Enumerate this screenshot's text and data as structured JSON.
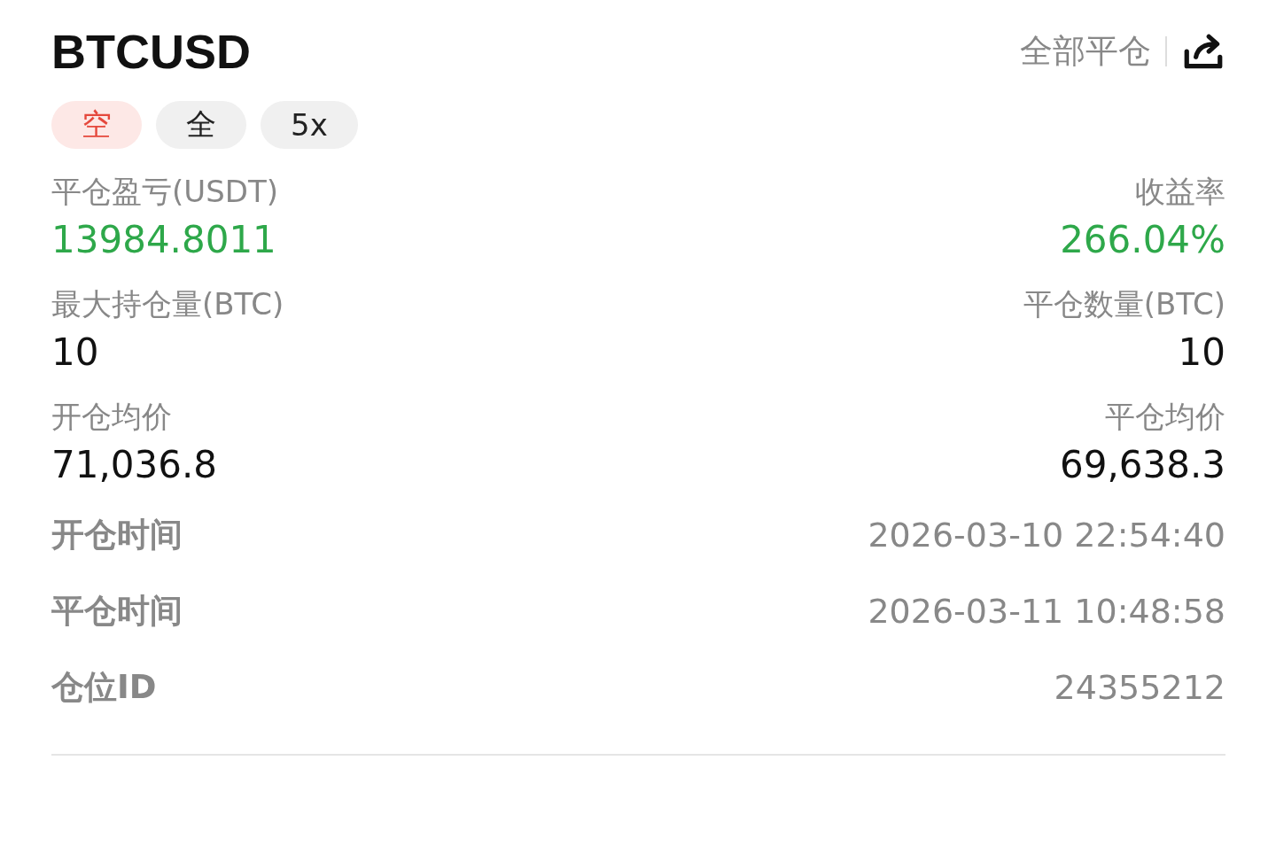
{
  "title": "BTCUSD",
  "close_all": "全部平仓",
  "tags": [
    {
      "label": "空",
      "kind": "side"
    },
    {
      "label": "全",
      "kind": "mode"
    },
    {
      "label": "5x",
      "kind": "mode"
    }
  ],
  "stats": [
    {
      "left": {
        "label": "平仓盈亏(USDT)",
        "value": "13984.8011",
        "positive": true
      },
      "right": {
        "label": "收益率",
        "value": "266.04%",
        "positive": true
      }
    },
    {
      "left": {
        "label": "最大持仓量(BTC)",
        "value": "10",
        "positive": false
      },
      "right": {
        "label": "平仓数量(BTC)",
        "value": "10",
        "positive": false
      }
    },
    {
      "left": {
        "label": "开仓均价",
        "value": "71,036.8",
        "positive": false
      },
      "right": {
        "label": "平仓均价",
        "value": "69,638.3",
        "positive": false
      }
    }
  ],
  "details": [
    {
      "label": "开仓时间",
      "value": "2026-03-10 22:54:40"
    },
    {
      "label": "平仓时间",
      "value": "2026-03-11 10:48:58"
    },
    {
      "label": "仓位ID",
      "value": "24355212"
    }
  ]
}
